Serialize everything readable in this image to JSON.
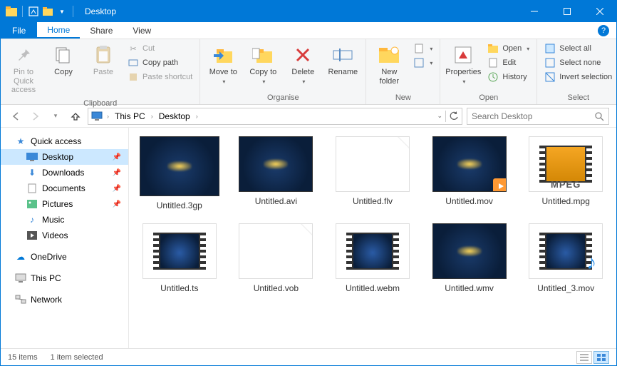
{
  "window": {
    "title": "Desktop"
  },
  "tabs": {
    "file": "File",
    "home": "Home",
    "share": "Share",
    "view": "View"
  },
  "ribbon": {
    "clipboard": {
      "label": "Clipboard",
      "pin": "Pin to Quick access",
      "copy": "Copy",
      "paste": "Paste",
      "cut": "Cut",
      "copy_path": "Copy path",
      "paste_shortcut": "Paste shortcut"
    },
    "organise": {
      "label": "Organise",
      "move_to": "Move to",
      "copy_to": "Copy to",
      "delete": "Delete",
      "rename": "Rename"
    },
    "new": {
      "label": "New",
      "new_folder": "New folder"
    },
    "open": {
      "label": "Open",
      "properties": "Properties",
      "open": "Open",
      "edit": "Edit",
      "history": "History"
    },
    "select": {
      "label": "Select",
      "select_all": "Select all",
      "select_none": "Select none",
      "invert": "Invert selection"
    }
  },
  "address": {
    "crumbs": [
      "This PC",
      "Desktop"
    ],
    "search_placeholder": "Search Desktop"
  },
  "nav": {
    "quick_access": "Quick access",
    "desktop": "Desktop",
    "downloads": "Downloads",
    "documents": "Documents",
    "pictures": "Pictures",
    "music": "Music",
    "videos": "Videos",
    "onedrive": "OneDrive",
    "this_pc": "This PC",
    "network": "Network"
  },
  "files": [
    {
      "name": "Untitled.3gp",
      "thumb": "video-big"
    },
    {
      "name": "Untitled.avi",
      "thumb": "video"
    },
    {
      "name": "Untitled.flv",
      "thumb": "blank"
    },
    {
      "name": "Untitled.mov",
      "thumb": "video-play"
    },
    {
      "name": "Untitled.mpg",
      "thumb": "mpeg"
    },
    {
      "name": "Untitled.ts",
      "thumb": "filmstrip"
    },
    {
      "name": "Untitled.vob",
      "thumb": "blank"
    },
    {
      "name": "Untitled.webm",
      "thumb": "filmstrip"
    },
    {
      "name": "Untitled.wmv",
      "thumb": "video"
    },
    {
      "name": "Untitled_3.mov",
      "thumb": "filmstrip-note"
    }
  ],
  "status": {
    "count": "15 items",
    "selected": "1 item selected"
  }
}
